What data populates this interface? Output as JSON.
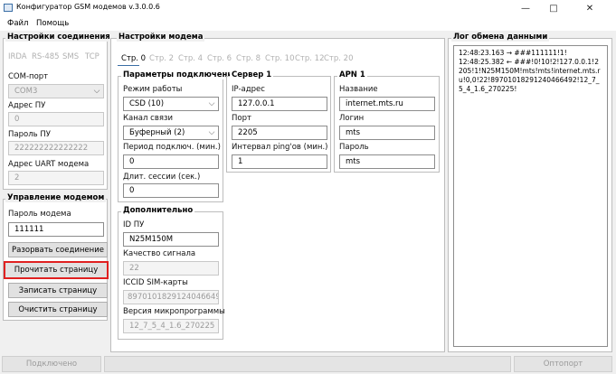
{
  "window": {
    "title": "Конфигуратор GSM модемов v.3.0.0.6"
  },
  "menu": {
    "file": "Файл",
    "help": "Помощь"
  },
  "conn": {
    "title": "Настройки соединения",
    "tabs": [
      "IRDA",
      "RS-485",
      "SMS",
      "TCP"
    ],
    "com_label": "COM-порт",
    "com_value": "COM3",
    "addr_label": "Адрес ПУ",
    "addr_value": "0",
    "pass_label": "Пароль ПУ",
    "pass_value": "222222222222222",
    "uart_label": "Адрес UART модема",
    "uart_value": "2"
  },
  "ctrl": {
    "title": "Управление модемом",
    "pass_label": "Пароль модема",
    "pass_value": "111111",
    "btn_disconnect": "Разорвать соединение",
    "btn_read": "Прочитать страницу",
    "btn_write": "Записать страницу",
    "btn_clear": "Очистить страницу"
  },
  "modem": {
    "title": "Настройки модема",
    "tabs": [
      "Стр. 0",
      "Стр. 2",
      "Стр. 4",
      "Стр. 6",
      "Стр. 8",
      "Стр. 10",
      "Стр. 12",
      "Стр. 20"
    ],
    "conn_params": {
      "title": "Параметры подключения",
      "mode_label": "Режим работы",
      "mode_value": "CSD (10)",
      "channel_label": "Канал связи",
      "channel_value": "Буферный (2)",
      "period_label": "Период подключ. (мин.)",
      "period_value": "0",
      "session_label": "Длит. сессии (сек.)",
      "session_value": "0"
    },
    "server": {
      "title": "Сервер 1",
      "ip_label": "IP-адрес",
      "ip_value": "127.0.0.1",
      "port_label": "Порт",
      "port_value": "2205",
      "ping_label": "Интервал ping'ов (мин.)",
      "ping_value": "1"
    },
    "apn": {
      "title": "APN 1",
      "name_label": "Название",
      "name_value": "internet.mts.ru",
      "login_label": "Логин",
      "login_value": "mts",
      "pass_label": "Пароль",
      "pass_value": "mts"
    },
    "extra": {
      "title": "Дополнительно",
      "id_label": "ID ПУ",
      "id_value": "N25M150M",
      "signal_label": "Качество сигнала",
      "signal_value": "22",
      "iccid_label": "ICCID SIM-карты",
      "iccid_value": "89701018291240466492",
      "fw_label": "Версия микропрограммы",
      "fw_value": "12_7_5_4_1.6_270225"
    }
  },
  "log": {
    "title": "Лог обмена данными",
    "text": "12:48:23.163 → ###111111!1!\n12:48:25.382 ← ###!0!10!2!127.0.0.1!2205!1!N25M150M!mts!mts!internet.mts.ru!0,0!22!89701018291240466492!12_7_5_4_1.6_270225!"
  },
  "status": {
    "left": "Подключено",
    "right": "Оптопорт"
  }
}
